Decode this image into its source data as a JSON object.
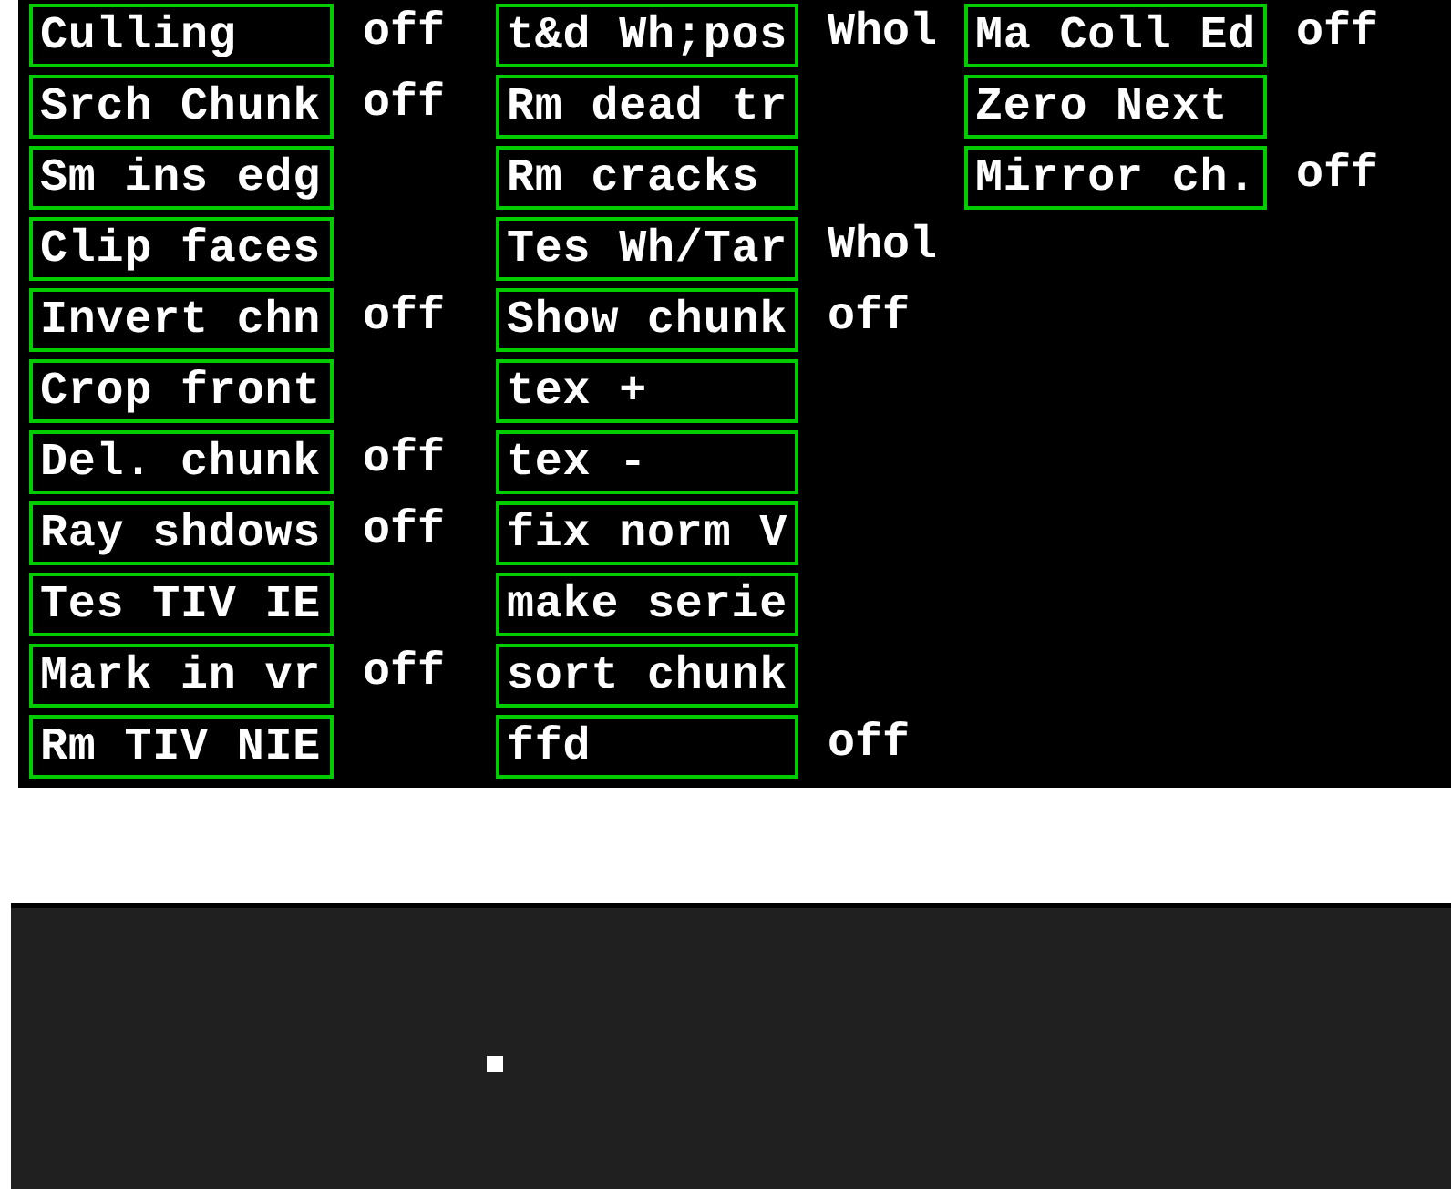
{
  "menu_columns": [
    {
      "items": [
        {
          "label": "Culling",
          "value": "off"
        },
        {
          "label": "Srch Chunk",
          "value": "off"
        },
        {
          "label": "Sm ins edg"
        },
        {
          "label": "Clip faces"
        },
        {
          "label": "Invert chn",
          "value": "off"
        },
        {
          "label": "Crop front"
        },
        {
          "label": "Del. chunk",
          "value": "off"
        },
        {
          "label": "Ray shdows",
          "value": "off"
        },
        {
          "label": "Tes TIV IE"
        },
        {
          "label": "Mark in vr",
          "value": "off"
        },
        {
          "label": "Rm TIV NIE"
        }
      ]
    },
    {
      "items": [
        {
          "label": "t&d Wh;pos",
          "value": "Whol"
        },
        {
          "label": "Rm dead tr"
        },
        {
          "label": "Rm cracks"
        },
        {
          "label": "Tes Wh/Tar",
          "value": "Whol"
        },
        {
          "label": "Show chunk",
          "value": "off"
        },
        {
          "label": "tex +"
        },
        {
          "label": "tex -"
        },
        {
          "label": "fix norm V"
        },
        {
          "label": "make serie"
        },
        {
          "label": "sort chunk"
        },
        {
          "label": "ffd",
          "value": "off"
        }
      ]
    },
    {
      "items": [
        {
          "label": "Ma Coll Ed",
          "value": "off"
        },
        {
          "label": "Zero Next"
        },
        {
          "label": "Mirror ch.",
          "value": "off"
        }
      ]
    }
  ]
}
